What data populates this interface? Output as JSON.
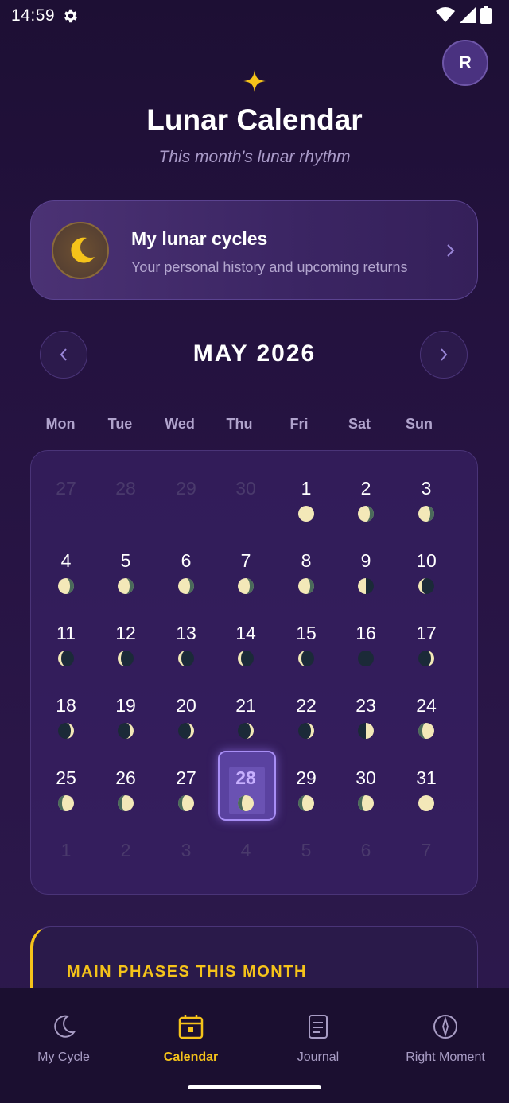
{
  "status": {
    "time": "14:59"
  },
  "header": {
    "avatar_initial": "R",
    "title": "Lunar Calendar",
    "subtitle": "This month's lunar rhythm"
  },
  "cycles_card": {
    "title": "My lunar cycles",
    "subtitle": "Your personal history and upcoming returns"
  },
  "calendar": {
    "month": "MAY 2026",
    "weekdays": [
      "Mon",
      "Tue",
      "Wed",
      "Thu",
      "Fri",
      "Sat",
      "Sun"
    ],
    "days": [
      {
        "n": "27",
        "outside": true
      },
      {
        "n": "28",
        "outside": true
      },
      {
        "n": "29",
        "outside": true
      },
      {
        "n": "30",
        "outside": true
      },
      {
        "n": "1",
        "phase": "full"
      },
      {
        "n": "2",
        "phase": "waning-gibbous"
      },
      {
        "n": "3",
        "phase": "waning-gibbous"
      },
      {
        "n": "4",
        "phase": "waning-gibbous"
      },
      {
        "n": "5",
        "phase": "waning-gibbous"
      },
      {
        "n": "6",
        "phase": "waning-gibbous"
      },
      {
        "n": "7",
        "phase": "waning-gibbous"
      },
      {
        "n": "8",
        "phase": "waning-gibbous"
      },
      {
        "n": "9",
        "phase": "last-quarter"
      },
      {
        "n": "10",
        "phase": "waning-crescent"
      },
      {
        "n": "11",
        "phase": "waning-crescent"
      },
      {
        "n": "12",
        "phase": "waning-crescent"
      },
      {
        "n": "13",
        "phase": "waning-crescent"
      },
      {
        "n": "14",
        "phase": "waning-crescent"
      },
      {
        "n": "15",
        "phase": "waning-crescent"
      },
      {
        "n": "16",
        "phase": "new"
      },
      {
        "n": "17",
        "phase": "waxing-crescent"
      },
      {
        "n": "18",
        "phase": "waxing-crescent"
      },
      {
        "n": "19",
        "phase": "waxing-crescent"
      },
      {
        "n": "20",
        "phase": "waxing-crescent"
      },
      {
        "n": "21",
        "phase": "waxing-crescent"
      },
      {
        "n": "22",
        "phase": "waxing-crescent"
      },
      {
        "n": "23",
        "phase": "first-quarter"
      },
      {
        "n": "24",
        "phase": "waxing-gibbous"
      },
      {
        "n": "25",
        "phase": "waxing-gibbous"
      },
      {
        "n": "26",
        "phase": "waxing-gibbous"
      },
      {
        "n": "27",
        "phase": "waxing-gibbous"
      },
      {
        "n": "28",
        "phase": "waxing-gibbous",
        "today": true
      },
      {
        "n": "29",
        "phase": "waxing-gibbous"
      },
      {
        "n": "30",
        "phase": "waxing-gibbous"
      },
      {
        "n": "31",
        "phase": "full"
      },
      {
        "n": "1",
        "outside": true
      },
      {
        "n": "2",
        "outside": true
      },
      {
        "n": "3",
        "outside": true
      },
      {
        "n": "4",
        "outside": true
      },
      {
        "n": "5",
        "outside": true
      },
      {
        "n": "6",
        "outside": true
      },
      {
        "n": "7",
        "outside": true
      }
    ]
  },
  "phases_section": {
    "title": "MAIN PHASES THIS MONTH"
  },
  "bottom_nav": {
    "tabs": [
      {
        "label": "My Cycle",
        "icon": "crescent-moon-icon"
      },
      {
        "label": "Calendar",
        "icon": "calendar-icon",
        "active": true
      },
      {
        "label": "Journal",
        "icon": "journal-icon"
      },
      {
        "label": "Right Moment",
        "icon": "compass-icon"
      }
    ]
  },
  "colors": {
    "accent": "#f5c31a",
    "today_border": "#a88ef5",
    "moon_light": "#f3e8b8",
    "moon_dark": "#1b2a38"
  }
}
